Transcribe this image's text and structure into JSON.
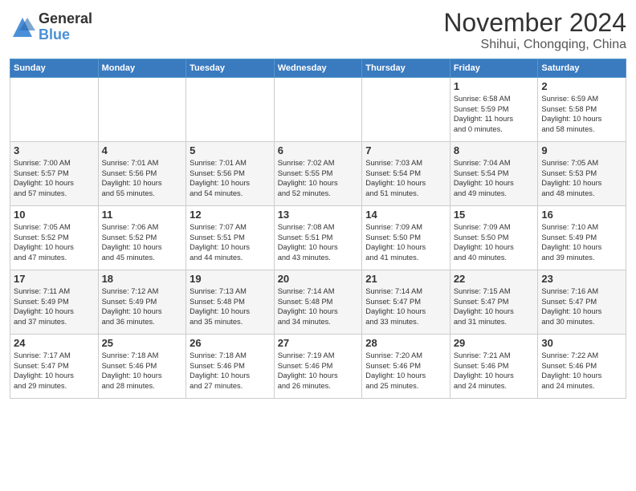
{
  "logo": {
    "general": "General",
    "blue": "Blue"
  },
  "header": {
    "month": "November 2024",
    "location": "Shihui, Chongqing, China"
  },
  "days_of_week": [
    "Sunday",
    "Monday",
    "Tuesday",
    "Wednesday",
    "Thursday",
    "Friday",
    "Saturday"
  ],
  "weeks": [
    [
      {
        "day": "",
        "info": ""
      },
      {
        "day": "",
        "info": ""
      },
      {
        "day": "",
        "info": ""
      },
      {
        "day": "",
        "info": ""
      },
      {
        "day": "",
        "info": ""
      },
      {
        "day": "1",
        "info": "Sunrise: 6:58 AM\nSunset: 5:59 PM\nDaylight: 11 hours\nand 0 minutes."
      },
      {
        "day": "2",
        "info": "Sunrise: 6:59 AM\nSunset: 5:58 PM\nDaylight: 10 hours\nand 58 minutes."
      }
    ],
    [
      {
        "day": "3",
        "info": "Sunrise: 7:00 AM\nSunset: 5:57 PM\nDaylight: 10 hours\nand 57 minutes."
      },
      {
        "day": "4",
        "info": "Sunrise: 7:01 AM\nSunset: 5:56 PM\nDaylight: 10 hours\nand 55 minutes."
      },
      {
        "day": "5",
        "info": "Sunrise: 7:01 AM\nSunset: 5:56 PM\nDaylight: 10 hours\nand 54 minutes."
      },
      {
        "day": "6",
        "info": "Sunrise: 7:02 AM\nSunset: 5:55 PM\nDaylight: 10 hours\nand 52 minutes."
      },
      {
        "day": "7",
        "info": "Sunrise: 7:03 AM\nSunset: 5:54 PM\nDaylight: 10 hours\nand 51 minutes."
      },
      {
        "day": "8",
        "info": "Sunrise: 7:04 AM\nSunset: 5:54 PM\nDaylight: 10 hours\nand 49 minutes."
      },
      {
        "day": "9",
        "info": "Sunrise: 7:05 AM\nSunset: 5:53 PM\nDaylight: 10 hours\nand 48 minutes."
      }
    ],
    [
      {
        "day": "10",
        "info": "Sunrise: 7:05 AM\nSunset: 5:52 PM\nDaylight: 10 hours\nand 47 minutes."
      },
      {
        "day": "11",
        "info": "Sunrise: 7:06 AM\nSunset: 5:52 PM\nDaylight: 10 hours\nand 45 minutes."
      },
      {
        "day": "12",
        "info": "Sunrise: 7:07 AM\nSunset: 5:51 PM\nDaylight: 10 hours\nand 44 minutes."
      },
      {
        "day": "13",
        "info": "Sunrise: 7:08 AM\nSunset: 5:51 PM\nDaylight: 10 hours\nand 43 minutes."
      },
      {
        "day": "14",
        "info": "Sunrise: 7:09 AM\nSunset: 5:50 PM\nDaylight: 10 hours\nand 41 minutes."
      },
      {
        "day": "15",
        "info": "Sunrise: 7:09 AM\nSunset: 5:50 PM\nDaylight: 10 hours\nand 40 minutes."
      },
      {
        "day": "16",
        "info": "Sunrise: 7:10 AM\nSunset: 5:49 PM\nDaylight: 10 hours\nand 39 minutes."
      }
    ],
    [
      {
        "day": "17",
        "info": "Sunrise: 7:11 AM\nSunset: 5:49 PM\nDaylight: 10 hours\nand 37 minutes."
      },
      {
        "day": "18",
        "info": "Sunrise: 7:12 AM\nSunset: 5:49 PM\nDaylight: 10 hours\nand 36 minutes."
      },
      {
        "day": "19",
        "info": "Sunrise: 7:13 AM\nSunset: 5:48 PM\nDaylight: 10 hours\nand 35 minutes."
      },
      {
        "day": "20",
        "info": "Sunrise: 7:14 AM\nSunset: 5:48 PM\nDaylight: 10 hours\nand 34 minutes."
      },
      {
        "day": "21",
        "info": "Sunrise: 7:14 AM\nSunset: 5:47 PM\nDaylight: 10 hours\nand 33 minutes."
      },
      {
        "day": "22",
        "info": "Sunrise: 7:15 AM\nSunset: 5:47 PM\nDaylight: 10 hours\nand 31 minutes."
      },
      {
        "day": "23",
        "info": "Sunrise: 7:16 AM\nSunset: 5:47 PM\nDaylight: 10 hours\nand 30 minutes."
      }
    ],
    [
      {
        "day": "24",
        "info": "Sunrise: 7:17 AM\nSunset: 5:47 PM\nDaylight: 10 hours\nand 29 minutes."
      },
      {
        "day": "25",
        "info": "Sunrise: 7:18 AM\nSunset: 5:46 PM\nDaylight: 10 hours\nand 28 minutes."
      },
      {
        "day": "26",
        "info": "Sunrise: 7:18 AM\nSunset: 5:46 PM\nDaylight: 10 hours\nand 27 minutes."
      },
      {
        "day": "27",
        "info": "Sunrise: 7:19 AM\nSunset: 5:46 PM\nDaylight: 10 hours\nand 26 minutes."
      },
      {
        "day": "28",
        "info": "Sunrise: 7:20 AM\nSunset: 5:46 PM\nDaylight: 10 hours\nand 25 minutes."
      },
      {
        "day": "29",
        "info": "Sunrise: 7:21 AM\nSunset: 5:46 PM\nDaylight: 10 hours\nand 24 minutes."
      },
      {
        "day": "30",
        "info": "Sunrise: 7:22 AM\nSunset: 5:46 PM\nDaylight: 10 hours\nand 24 minutes."
      }
    ]
  ]
}
